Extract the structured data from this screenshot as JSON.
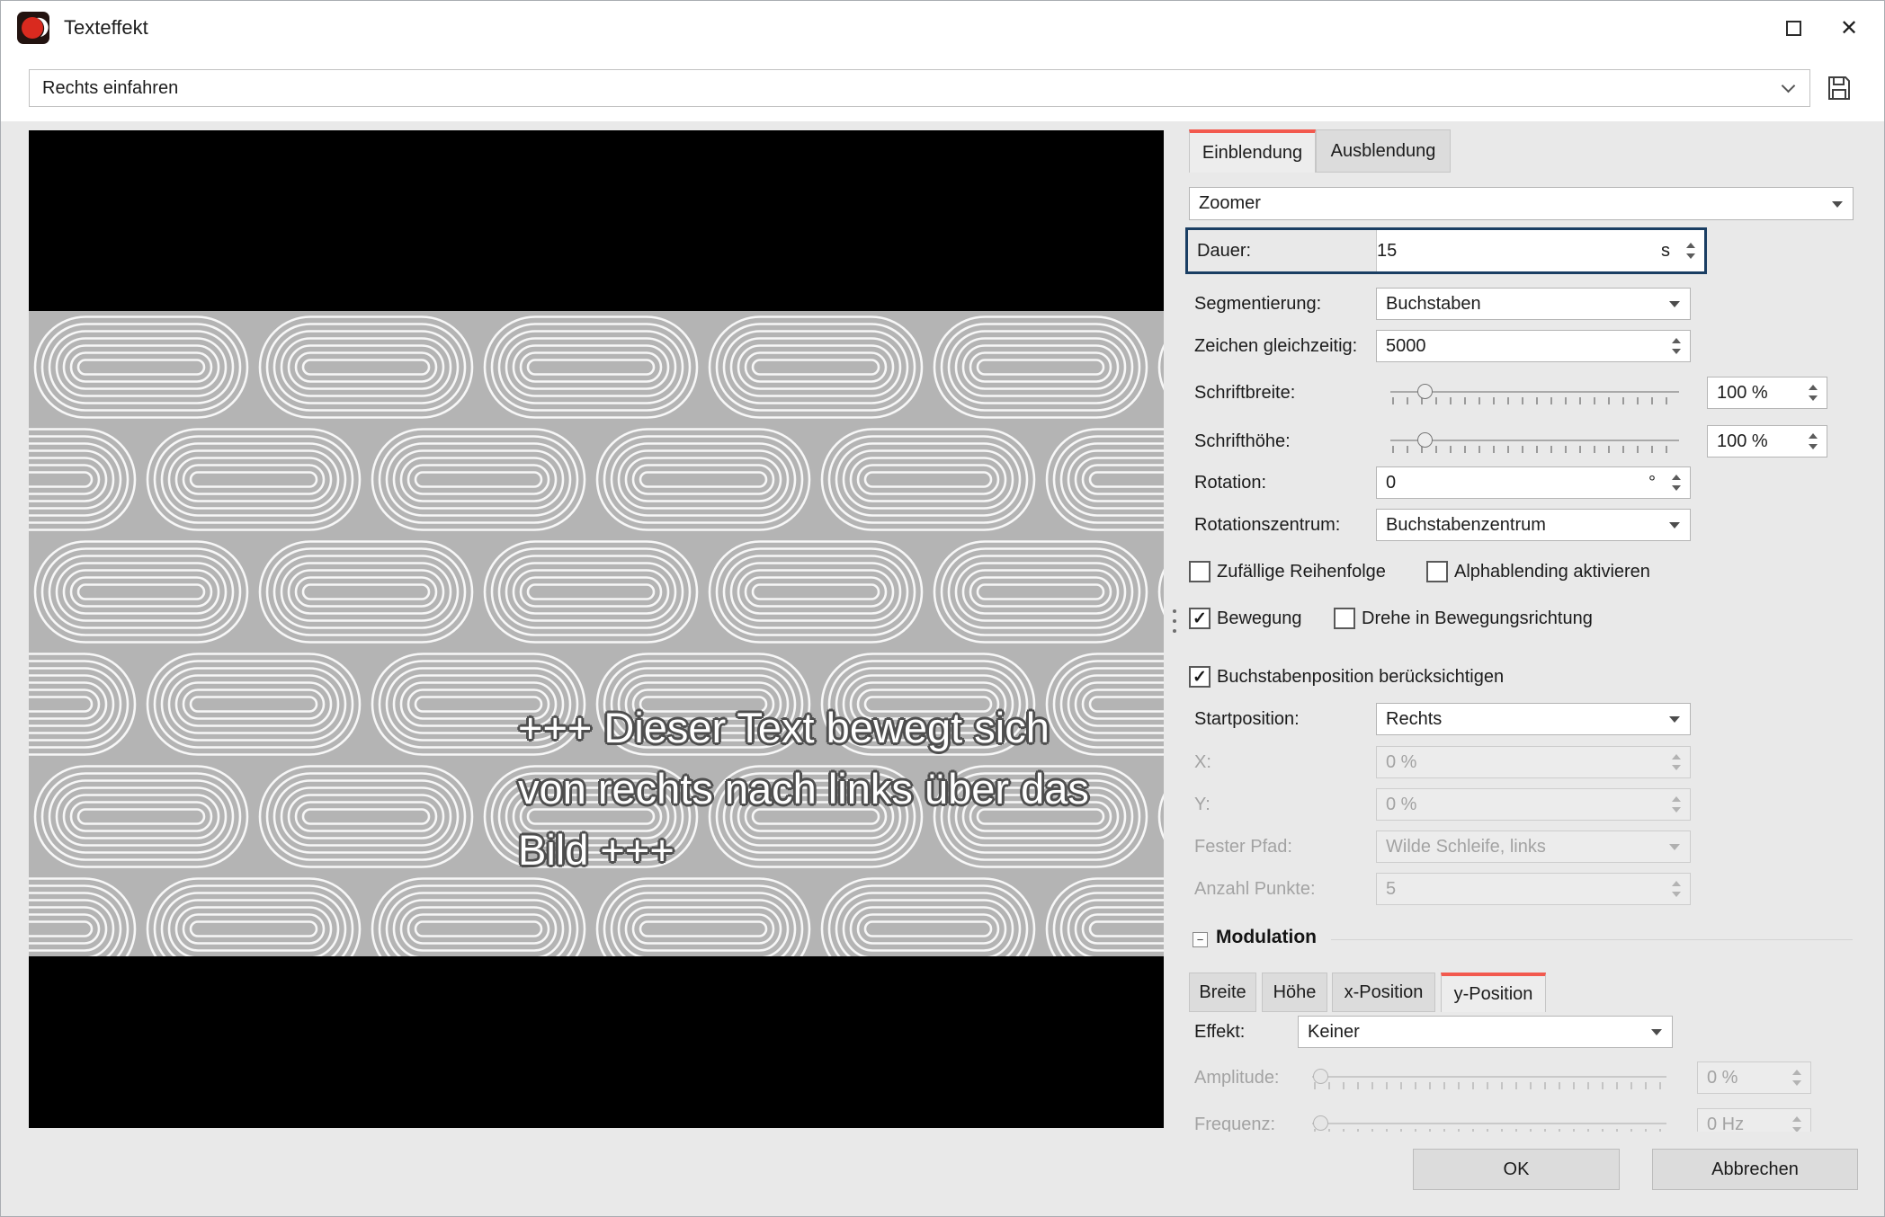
{
  "window": {
    "title": "Texteffekt"
  },
  "icons": {
    "close": "✕",
    "checkmark": "✓",
    "minus": "−"
  },
  "preset": {
    "value": "Rechts einfahren"
  },
  "preview": {
    "line1": "+++ Dieser Text bewegt sich",
    "line2": "von rechts nach links über das",
    "line3": "Bild +++"
  },
  "tabs": {
    "einblendung": "Einblendung",
    "ausblendung": "Ausblendung"
  },
  "effect_dropdown": {
    "value": "Zoomer"
  },
  "fields": {
    "dauer": {
      "label": "Dauer:",
      "value": "15",
      "unit": "s"
    },
    "segmentierung": {
      "label": "Segmentierung:",
      "value": "Buchstaben"
    },
    "zeichen_gleichzeitig": {
      "label": "Zeichen gleichzeitig:",
      "value": "5000"
    },
    "schriftbreite": {
      "label": "Schriftbreite:",
      "value": "100 %"
    },
    "schrifthoehe": {
      "label": "Schrifthöhe:",
      "value": "100 %"
    },
    "rotation": {
      "label": "Rotation:",
      "value": "0",
      "unit": "°"
    },
    "rotationszentrum": {
      "label": "Rotationszentrum:",
      "value": "Buchstabenzentrum"
    },
    "startposition": {
      "label": "Startposition:",
      "value": "Rechts"
    },
    "x": {
      "label": "X:",
      "value": "0 %"
    },
    "y": {
      "label": "Y:",
      "value": "0 %"
    },
    "fester_pfad": {
      "label": "Fester Pfad:",
      "value": "Wilde Schleife, links"
    },
    "anzahl_punkte": {
      "label": "Anzahl Punkte:",
      "value": "5"
    }
  },
  "checkboxes": {
    "zufaellige_reihenfolge": {
      "label": "Zufällige Reihenfolge",
      "checked": false
    },
    "alphablending": {
      "label": "Alphablending aktivieren",
      "checked": false
    },
    "bewegung": {
      "label": "Bewegung",
      "checked": true
    },
    "drehe": {
      "label": "Drehe in Bewegungsrichtung",
      "checked": false
    },
    "buchstabenposition": {
      "label": "Buchstabenposition berücksichtigen",
      "checked": true
    }
  },
  "modulation": {
    "title": "Modulation",
    "tabs": [
      "Breite",
      "Höhe",
      "x-Position",
      "y-Position"
    ],
    "effekt": {
      "label": "Effekt:",
      "value": "Keiner"
    },
    "amplitude": {
      "label": "Amplitude:",
      "value": "0 %"
    },
    "frequenz": {
      "label": "Frequenz:",
      "value": "0 Hz"
    }
  },
  "buttons": {
    "ok": "OK",
    "cancel": "Abbrechen"
  },
  "colors": {
    "accent_red": "#f2594e",
    "focus_border": "#1a3e63"
  }
}
